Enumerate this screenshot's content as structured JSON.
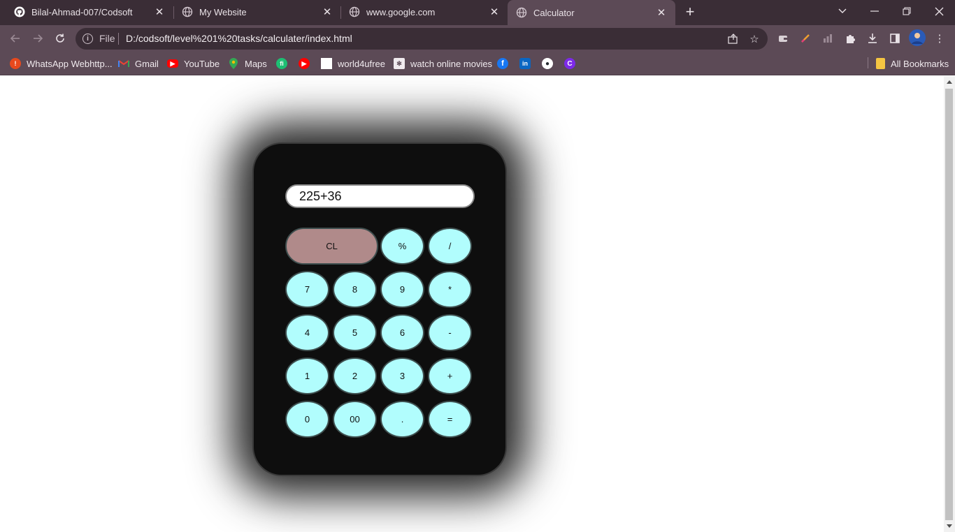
{
  "tabs": [
    {
      "title": "Bilal-Ahmad-007/Codsoft",
      "icon": "github-icon"
    },
    {
      "title": "My Website",
      "icon": "globe-icon"
    },
    {
      "title": "www.google.com",
      "icon": "globe-icon"
    },
    {
      "title": "Calculator",
      "icon": "globe-icon",
      "active": true
    }
  ],
  "omnibox": {
    "scheme_label": "File",
    "url": "D:/codsoft/level%201%20tasks/calculater/index.html"
  },
  "bookmarks": [
    {
      "label": "WhatsApp Webhttp...",
      "icon": "whatsapp-icon"
    },
    {
      "label": "Gmail",
      "icon": "gmail-icon"
    },
    {
      "label": "YouTube",
      "icon": "youtube-icon"
    },
    {
      "label": "Maps",
      "icon": "maps-icon"
    },
    {
      "label": "",
      "icon": "fiverr-icon"
    },
    {
      "label": "",
      "icon": "youtube-icon"
    },
    {
      "label": "world4ufree",
      "icon": "page-icon"
    },
    {
      "label": "watch online movies",
      "icon": "movies-icon"
    },
    {
      "label": "",
      "icon": "facebook-icon"
    },
    {
      "label": "",
      "icon": "linkedin-icon"
    },
    {
      "label": "",
      "icon": "github-icon"
    },
    {
      "label": "",
      "icon": "canva-icon"
    }
  ],
  "all_bookmarks": "All Bookmarks",
  "calculator": {
    "display": "225+36",
    "keys": {
      "clear": "CL",
      "percent": "%",
      "divide": "/",
      "k7": "7",
      "k8": "8",
      "k9": "9",
      "multiply": "*",
      "k4": "4",
      "k5": "5",
      "k6": "6",
      "minus": "-",
      "k1": "1",
      "k2": "2",
      "k3": "3",
      "plus": "+",
      "k0": "0",
      "k00": "00",
      "dot": ".",
      "equals": "="
    }
  },
  "colors": {
    "chrome_dark": "#3a2d36",
    "chrome_light": "#5c4a56",
    "calc_body": "#0e0e0e",
    "key": "#b1fdfd",
    "clear_key": "#b08a8a"
  }
}
